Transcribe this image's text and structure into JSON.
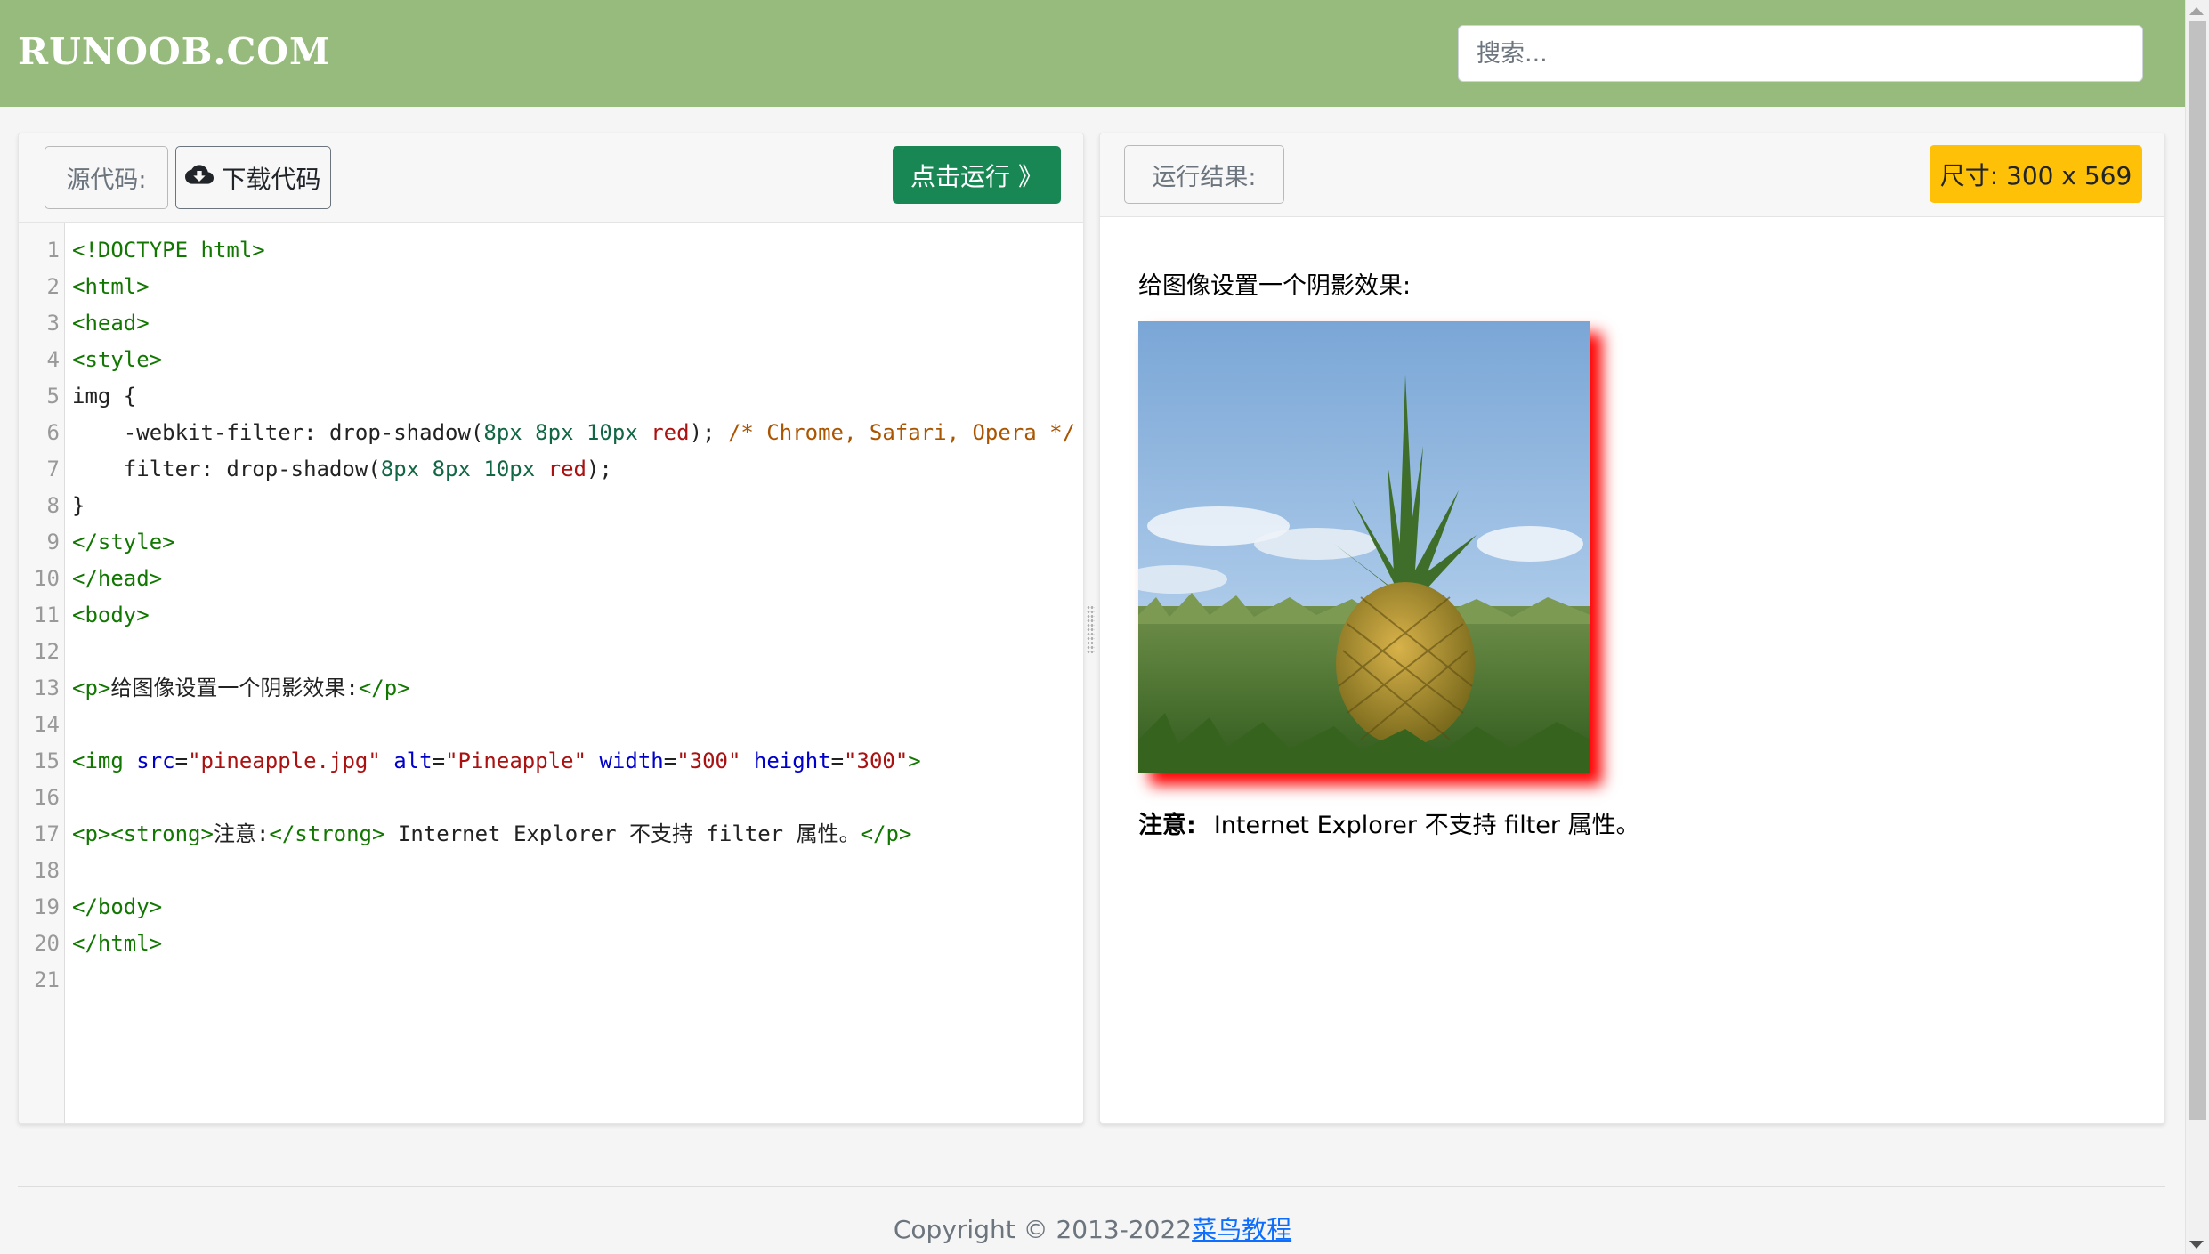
{
  "header": {
    "logo_text": "RUNOOB.COM",
    "search_placeholder": "搜索..."
  },
  "editor": {
    "source_label": "源代码:",
    "download_label": "下载代码",
    "download_icon": "cloud-download-icon",
    "run_label": "点击运行 》",
    "line_count": 21,
    "lines": [
      [
        [
          "tag",
          "<!DOCTYPE html>"
        ]
      ],
      [
        [
          "tag",
          "<html>"
        ]
      ],
      [
        [
          "tag",
          "<head>"
        ]
      ],
      [
        [
          "tag",
          "<style>"
        ]
      ],
      [
        [
          "pl",
          "img {"
        ]
      ],
      [
        [
          "pl",
          "    -webkit-filter: drop-shadow("
        ],
        [
          "num",
          "8px 8px 10px "
        ],
        [
          "str",
          "red"
        ],
        [
          "pl",
          "); "
        ],
        [
          "com",
          "/* Chrome, Safari, Opera */"
        ]
      ],
      [
        [
          "pl",
          "    filter: drop-shadow("
        ],
        [
          "num",
          "8px 8px 10px "
        ],
        [
          "str",
          "red"
        ],
        [
          "pl",
          ");"
        ]
      ],
      [
        [
          "pl",
          "}"
        ]
      ],
      [
        [
          "tag",
          "</style>"
        ]
      ],
      [
        [
          "tag",
          "</head>"
        ]
      ],
      [
        [
          "tag",
          "<body>"
        ]
      ],
      [],
      [
        [
          "tag",
          "<p>"
        ],
        [
          "pl",
          "给图像设置一个阴影效果:"
        ],
        [
          "tag",
          "</p>"
        ]
      ],
      [],
      [
        [
          "tag",
          "<img "
        ],
        [
          "att",
          "src"
        ],
        [
          "pl",
          "="
        ],
        [
          "str",
          "\"pineapple.jpg\""
        ],
        [
          "pl",
          " "
        ],
        [
          "att",
          "alt"
        ],
        [
          "pl",
          "="
        ],
        [
          "str",
          "\"Pineapple\""
        ],
        [
          "pl",
          " "
        ],
        [
          "att",
          "width"
        ],
        [
          "pl",
          "="
        ],
        [
          "str",
          "\"300\""
        ],
        [
          "pl",
          " "
        ],
        [
          "att",
          "height"
        ],
        [
          "pl",
          "="
        ],
        [
          "str",
          "\"300\""
        ],
        [
          "tag",
          ">"
        ]
      ],
      [],
      [
        [
          "tag",
          "<p><strong>"
        ],
        [
          "pl",
          "注意:"
        ],
        [
          "tag",
          "</strong>"
        ],
        [
          "pl",
          " Internet Explorer 不支持 filter 属性。"
        ],
        [
          "tag",
          "</p>"
        ]
      ],
      [],
      [
        [
          "tag",
          "</body>"
        ]
      ],
      [
        [
          "tag",
          "</html>"
        ]
      ],
      []
    ]
  },
  "result": {
    "label": "运行结果:",
    "size_label": "尺寸: 300 x 569",
    "paragraph": "给图像设置一个阴影效果:",
    "image_alt": "Pineapple",
    "note_strong": "注意:",
    "note_text": "Internet Explorer 不支持 filter 属性。"
  },
  "footer": {
    "copyright": "Copyright © 2013-2022",
    "link_text": "菜鸟教程"
  },
  "colors": {
    "header_bg": "#96bb7c",
    "run_button": "#198754",
    "size_badge": "#ffc107",
    "shadow": "#ff0000"
  }
}
